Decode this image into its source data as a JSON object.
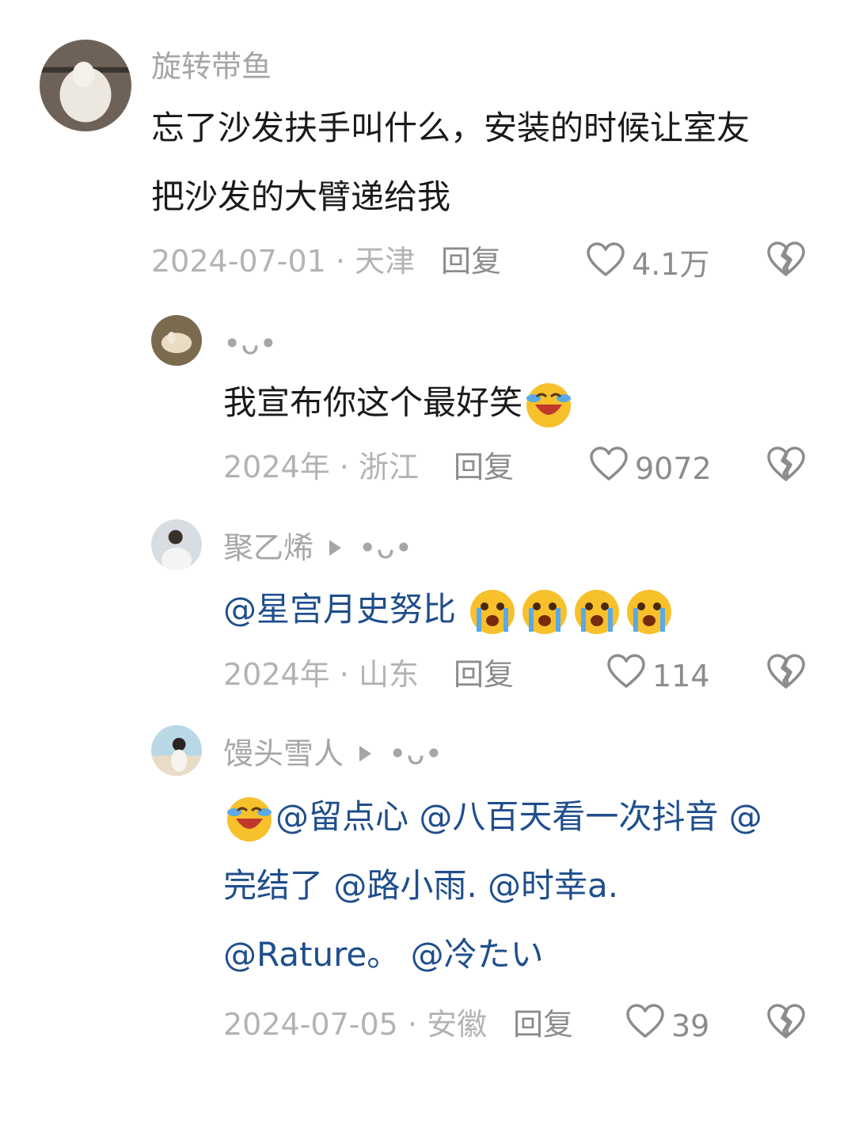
{
  "comments": [
    {
      "user": "旋转带鱼",
      "lines": [
        [
          {
            "t": "忘了沙发扶手叫什么，安装的时候让室友"
          }
        ],
        [
          {
            "t": "把沙发的大臂递给我"
          }
        ]
      ],
      "meta": "2024-07-01 · 天津",
      "reply": "回复",
      "likes": "4.1万"
    },
    {
      "user": "•ᴗ•",
      "lines": [
        [
          {
            "t": "我宣布你这个最好笑"
          },
          {
            "emoji": "laugh-cry-emoji"
          }
        ]
      ],
      "meta": "2024年 · 浙江",
      "reply": "回复",
      "likes": "9072"
    },
    {
      "user": "聚乙烯",
      "reply_to": "•ᴗ•",
      "lines": [
        [
          {
            "t": "@星宫月史努比 ",
            "mention": true
          },
          {
            "emoji": "crying-emoji"
          },
          {
            "emoji": "crying-emoji"
          },
          {
            "emoji": "crying-emoji"
          },
          {
            "emoji": "crying-emoji"
          }
        ]
      ],
      "meta": "2024年 · 山东",
      "reply": "回复",
      "likes": "114"
    },
    {
      "user": "馒头雪人",
      "reply_to": "•ᴗ•",
      "lines": [
        [
          {
            "emoji": "laugh-cry-emoji"
          },
          {
            "t": "@留点心 @八百天看一次抖音 @",
            "mention": true
          }
        ],
        [
          {
            "t": "完结了 @路小雨. @时幸a.",
            "mention": true
          }
        ],
        [
          {
            "t": "@Rature。 @冷たい",
            "mention": true
          }
        ]
      ],
      "meta": "2024-07-05 · 安徽",
      "reply": "回复",
      "likes": "39"
    }
  ],
  "colors": {
    "text": "#1a1a1a",
    "mention": "#1f4e8c",
    "meta": "#b3b3b3",
    "icon": "#8c8c8c"
  }
}
